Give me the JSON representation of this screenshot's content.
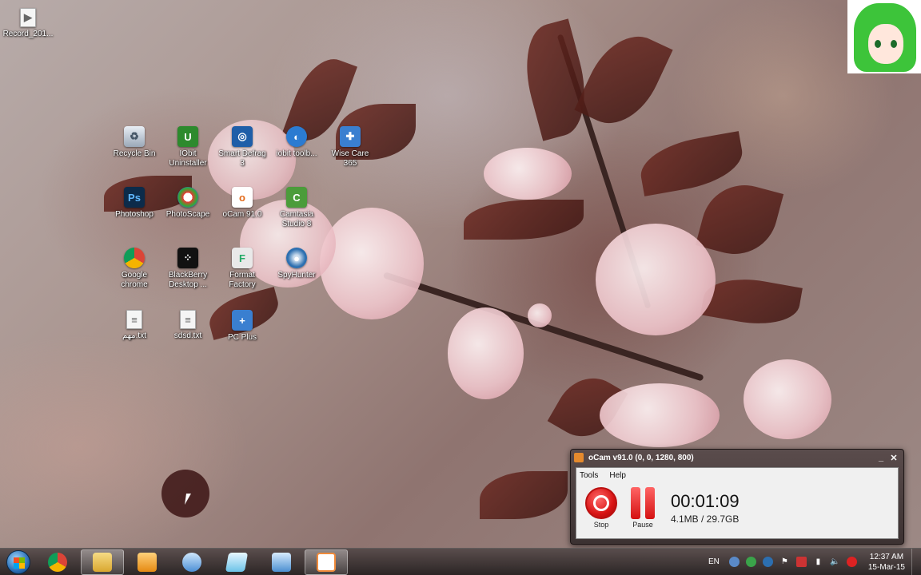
{
  "desktop": {
    "icons": [
      {
        "label": "Record_201...",
        "icon": "video-file-icon"
      },
      {
        "label": "Recycle Bin",
        "icon": "recycle-bin-icon"
      },
      {
        "label": "IObit\nUninstaller",
        "icon": "iobit-uninstaller-icon"
      },
      {
        "label": "Smart Defrag\n3",
        "icon": "smart-defrag-icon"
      },
      {
        "label": "iobit toolb...",
        "icon": "iobit-toolbar-icon"
      },
      {
        "label": "Wise Care\n365",
        "icon": "wise-care-icon"
      },
      {
        "label": "Photoshop",
        "icon": "photoshop-icon"
      },
      {
        "label": "PhotoScape",
        "icon": "photoscape-icon"
      },
      {
        "label": "oCam 91.0",
        "icon": "ocam-icon"
      },
      {
        "label": "Camtasia\nStudio 8",
        "icon": "camtasia-icon"
      },
      {
        "label": "Google\nchrome",
        "icon": "chrome-icon"
      },
      {
        "label": "BlackBerry\nDesktop ...",
        "icon": "blackberry-icon"
      },
      {
        "label": "Format\nFactory",
        "icon": "format-factory-icon"
      },
      {
        "label": "SpyHunter",
        "icon": "spyhunter-icon"
      },
      {
        "label": "مهم.txt",
        "icon": "text-file-icon"
      },
      {
        "label": "sdsd.txt",
        "icon": "text-file-icon"
      },
      {
        "label": "PC Plus",
        "icon": "pc-plus-icon"
      }
    ]
  },
  "ocam": {
    "title": "oCam v91.0 (0, 0, 1280, 800)",
    "menu": [
      "Tools",
      "Help"
    ],
    "stop_label": "Stop",
    "pause_label": "Pause",
    "elapsed": "00:01:09",
    "size": "4.1MB / 29.7GB",
    "minimize": "_",
    "close": "✕"
  },
  "taskbar": {
    "pinned": [
      {
        "name": "chrome",
        "icon": "chrome-icon",
        "color": "#e4452f",
        "active": false
      },
      {
        "name": "explorer",
        "icon": "folder-icon",
        "color": "#e8c15a",
        "active": true
      },
      {
        "name": "media-player",
        "icon": "media-player-icon",
        "color": "#f0a326",
        "active": false
      },
      {
        "name": "paint",
        "icon": "paint-icon",
        "color": "#5aa0dc",
        "active": false
      },
      {
        "name": "notes",
        "icon": "notes-icon",
        "color": "#6cc3e8",
        "active": false
      },
      {
        "name": "network",
        "icon": "network-computer-icon",
        "color": "#4b8fd0",
        "active": false
      },
      {
        "name": "ocam",
        "icon": "ocam-icon",
        "color": "#f08a3a",
        "active": true
      }
    ],
    "lang": "EN",
    "time": "12:37 AM",
    "date": "15-Mar-15"
  },
  "colors": {
    "record_red": "#d81414",
    "ocam_frame": "#3c3232"
  }
}
